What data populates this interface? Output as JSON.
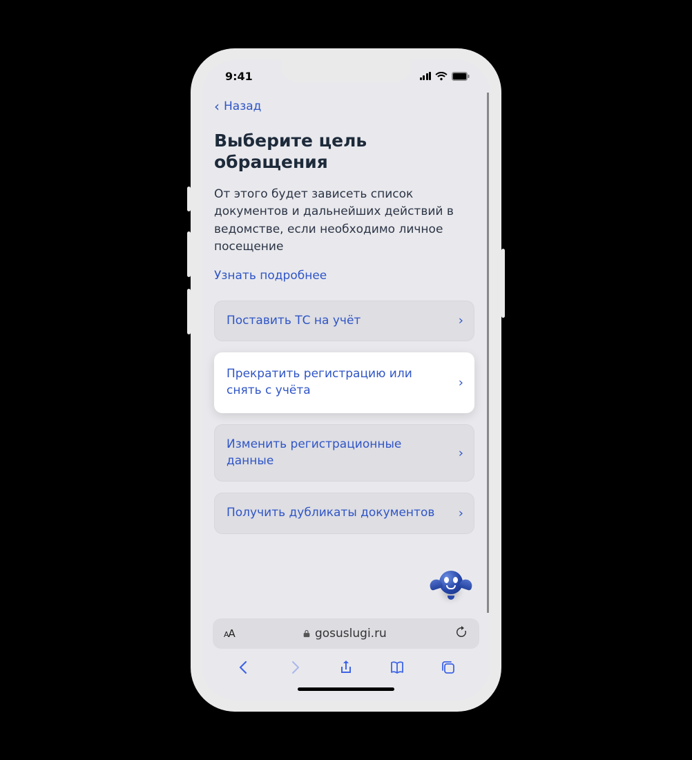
{
  "status": {
    "time": "9:41"
  },
  "back_label": "Назад",
  "title": "Выберите цель обращения",
  "description": "От этого будет зависеть список документов и дальнейших действий в ведомстве, если необходимо личное посещение",
  "learn_more": "Узнать подробнее",
  "options": [
    {
      "label": "Поставить ТС на учёт",
      "highlight": false
    },
    {
      "label": "Прекратить регистрацию или снять с учёта",
      "highlight": true
    },
    {
      "label": "Изменить регистрационные данные",
      "highlight": false
    },
    {
      "label": "Получить дубликаты документов",
      "highlight": false
    }
  ],
  "url_bar": {
    "domain": "gosuslugi.ru",
    "reader_label": "AA"
  },
  "colors": {
    "link": "#2f55c6",
    "title": "#1d2a3a"
  }
}
